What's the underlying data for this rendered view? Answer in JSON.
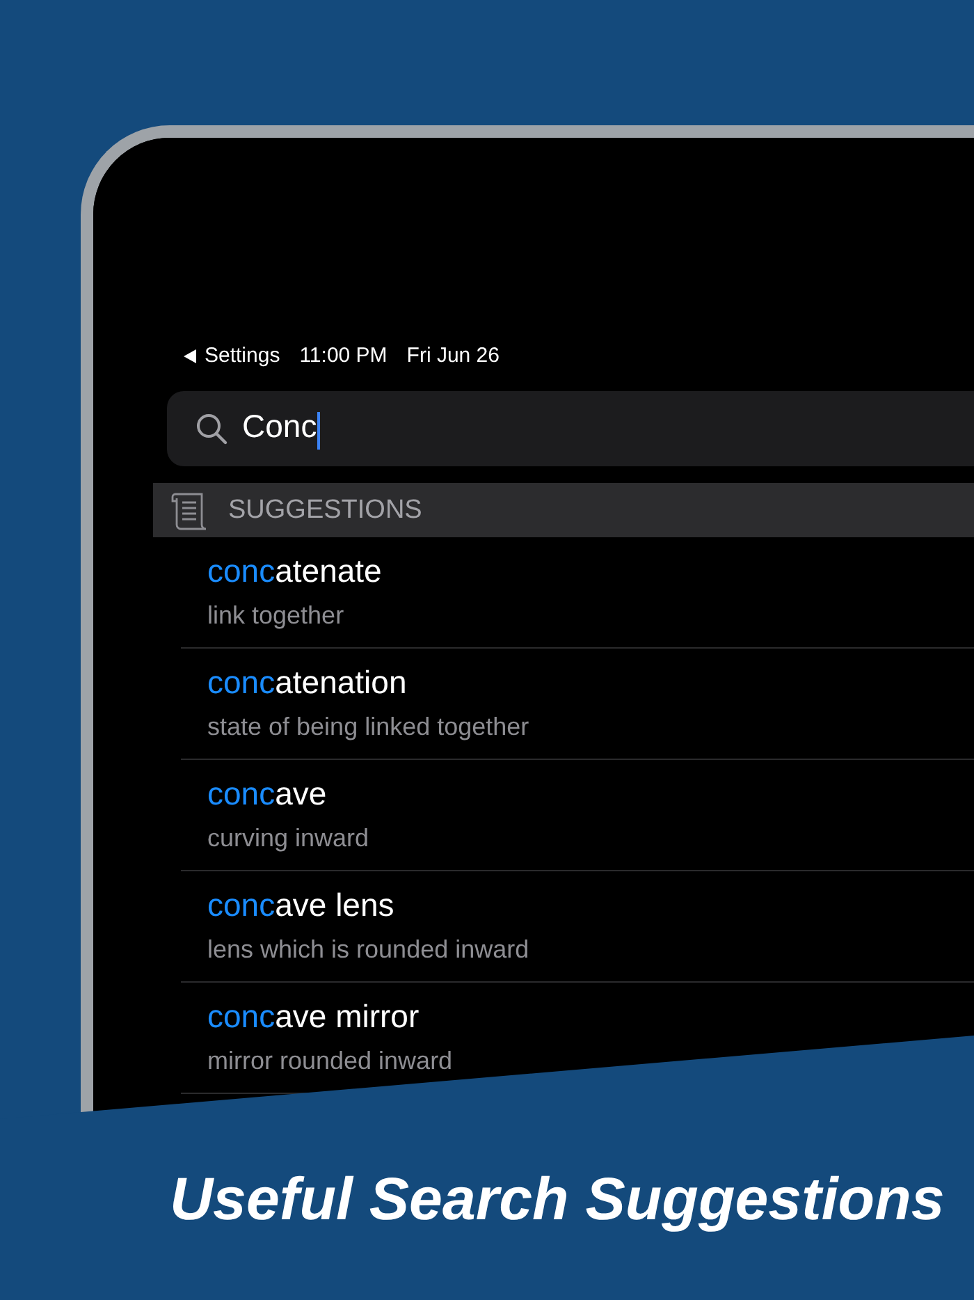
{
  "status_bar": {
    "back_label": "Settings",
    "time": "11:00 PM",
    "date": "Fri Jun 26"
  },
  "search": {
    "value": "Conc"
  },
  "section": {
    "title": "SUGGESTIONS"
  },
  "suggestions": [
    {
      "match": "conc",
      "rest": "atenate",
      "definition": "link together"
    },
    {
      "match": "conc",
      "rest": "atenation",
      "definition": "state of being linked together"
    },
    {
      "match": "conc",
      "rest": "ave",
      "definition": "curving inward"
    },
    {
      "match": "conc",
      "rest": "ave lens",
      "definition": "lens which is rounded inward"
    },
    {
      "match": "conc",
      "rest": "ave mirror",
      "definition": "mirror rounded inward"
    }
  ],
  "caption": "Useful Search Suggestions"
}
